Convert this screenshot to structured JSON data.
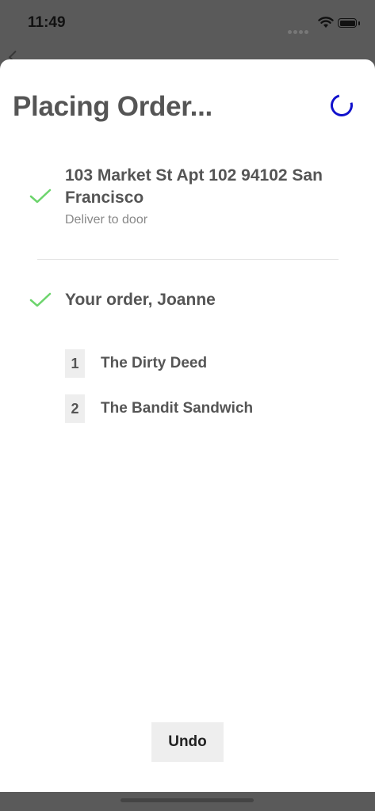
{
  "status_bar": {
    "time": "11:49"
  },
  "sheet": {
    "title": "Placing Order...",
    "address": {
      "line": "103 Market St Apt 102 94102 San Francisco",
      "note": "Deliver to door"
    },
    "order": {
      "heading": "Your order, Joanne",
      "items": [
        {
          "qty": "1",
          "name": "The Dirty Deed"
        },
        {
          "qty": "2",
          "name": "The Bandit Sandwich"
        }
      ]
    },
    "undo_label": "Undo"
  },
  "colors": {
    "accent_spinner": "#1111cc",
    "check_green": "#6cd46c",
    "text": "#555555",
    "overlay": "#5a5a5a"
  }
}
